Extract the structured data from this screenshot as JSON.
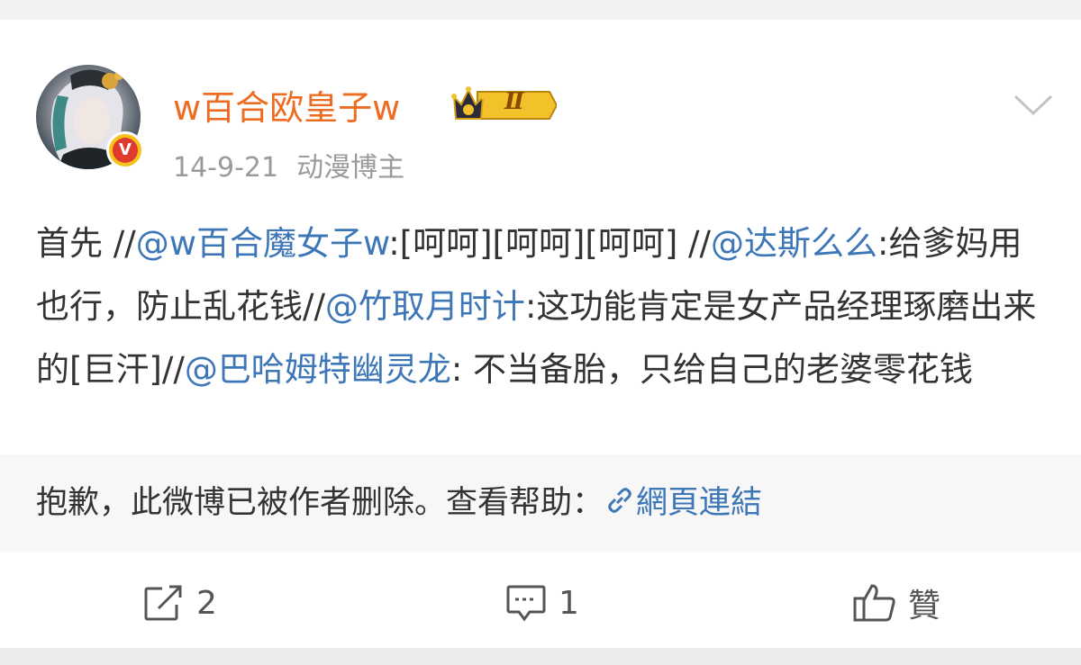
{
  "post": {
    "username": "w百合欧皇子w",
    "vip_level": "Ⅱ",
    "verify_mark": "V",
    "date": "14-9-21",
    "source": "动漫博主",
    "text_parts": {
      "p1": "首先 //",
      "m1": "@w百合魔女子w",
      "p2": ":[呵呵][呵呵][呵呵] //",
      "m2": "@达斯么么",
      "p3": ":给爹妈用也行，防止乱花钱//",
      "m3": "@竹取月时计",
      "p4": ":这功能肯定是女产品经理琢磨出来的[巨汗]//",
      "m4": "@巴哈姆特幽灵龙",
      "p5": ": 不当备胎，只给自己的老婆零花钱"
    }
  },
  "deleted_notice": {
    "text": "抱歉，此微博已被作者删除。查看帮助：",
    "link_label": "網頁連結"
  },
  "actions": {
    "repost_count": "2",
    "comment_count": "1",
    "like_label": "贊"
  },
  "colors": {
    "username": "#ee6c21",
    "mention": "#3d77b8",
    "meta": "#9a9a9a",
    "badge_gold": "#f6c21c",
    "badge_red": "#e03a2f"
  },
  "icons": [
    "chevron-down-icon",
    "verified-v-icon",
    "vip-crown-icon",
    "link-icon",
    "repost-icon",
    "comment-icon",
    "like-icon"
  ]
}
